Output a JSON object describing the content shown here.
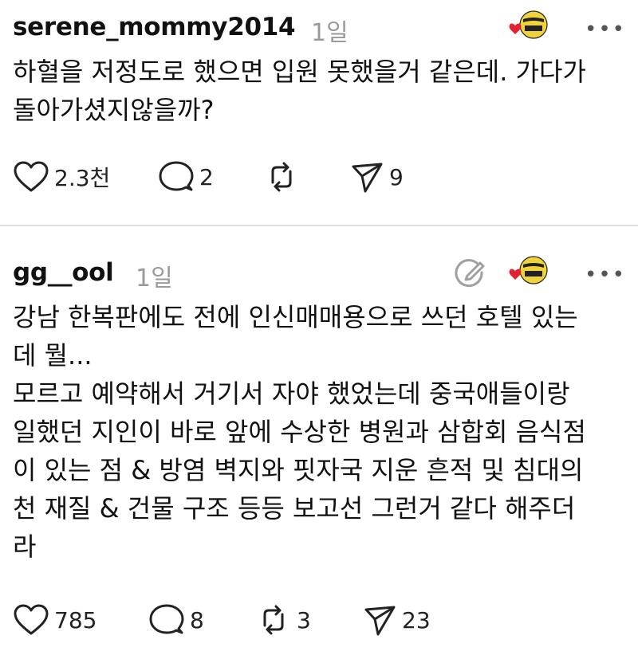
{
  "posts": [
    {
      "username": "serene_mommy2014",
      "time": "1일",
      "text": "하혈을 저정도로 했으면 입원 못했을거 같은데. 가다가\n돌아가셨지않을까?",
      "likes": "2.3천",
      "replies": "2",
      "reposts": "",
      "shares": "9"
    },
    {
      "username": "gg__ool",
      "time": "1일",
      "text": "강남 한복판에도 전에 인신매매용으로 쓰던 호텔 있는\n데 뭘...\n모르고 예약해서 거기서 자야 했었는데 중국애들이랑\n일했던 지인이 바로 앞에 수상한 병원과 삼합회 음식점\n이 있는 점 & 방염 벽지와 핏자국 지운 흔적 및 침대의\n천 재질 & 건물 구조 등등 보고선 그런거 같다 해주더\n라",
      "likes": "785",
      "replies": "8",
      "reposts": "3",
      "shares": "23"
    }
  ],
  "more_label": "•••",
  "colors": {
    "heart": "#e3222f",
    "muted": "#9a9a9a",
    "divider": "#dddddd"
  },
  "icons": [
    "heart-icon",
    "comment-icon",
    "repost-icon",
    "share-icon",
    "edit-icon",
    "more-icon",
    "badge-icon"
  ]
}
